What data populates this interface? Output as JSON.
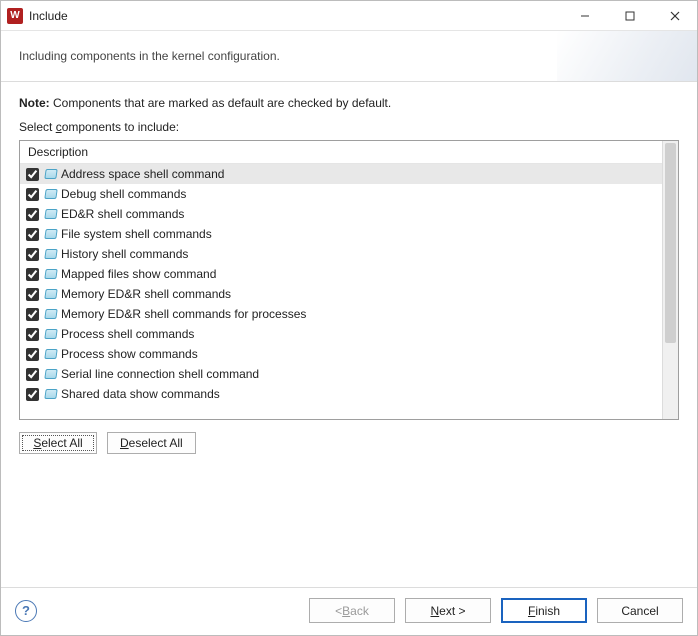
{
  "window": {
    "app_icon_letter": "W",
    "title": "Include"
  },
  "header": {
    "subtitle": "Including components in the kernel configuration."
  },
  "body": {
    "note_label": "Note:",
    "note_text": "Components that are marked as default are checked by default.",
    "select_prefix": "Select ",
    "select_u": "c",
    "select_suffix": "omponents to include:",
    "column_header": "Description"
  },
  "components": [
    {
      "label": "Address space shell command",
      "checked": true,
      "selected": true
    },
    {
      "label": "Debug shell commands",
      "checked": true,
      "selected": false
    },
    {
      "label": "ED&R shell commands",
      "checked": true,
      "selected": false
    },
    {
      "label": "File system shell commands",
      "checked": true,
      "selected": false
    },
    {
      "label": "History shell commands",
      "checked": true,
      "selected": false
    },
    {
      "label": "Mapped files show command",
      "checked": true,
      "selected": false
    },
    {
      "label": "Memory ED&R shell commands",
      "checked": true,
      "selected": false
    },
    {
      "label": "Memory ED&R shell commands for processes",
      "checked": true,
      "selected": false
    },
    {
      "label": "Process shell commands",
      "checked": true,
      "selected": false
    },
    {
      "label": "Process show commands",
      "checked": true,
      "selected": false
    },
    {
      "label": "Serial line connection shell command",
      "checked": true,
      "selected": false
    },
    {
      "label": "Shared data show commands",
      "checked": true,
      "selected": false
    }
  ],
  "buttons": {
    "select_all_u": "S",
    "select_all_rest": "elect All",
    "deselect_all_u": "D",
    "deselect_all_rest": "eselect All",
    "back_prefix": "< ",
    "back_u": "B",
    "back_rest": "ack",
    "next_u": "N",
    "next_rest": "ext >",
    "finish_u": "F",
    "finish_rest": "inish",
    "cancel": "Cancel"
  }
}
